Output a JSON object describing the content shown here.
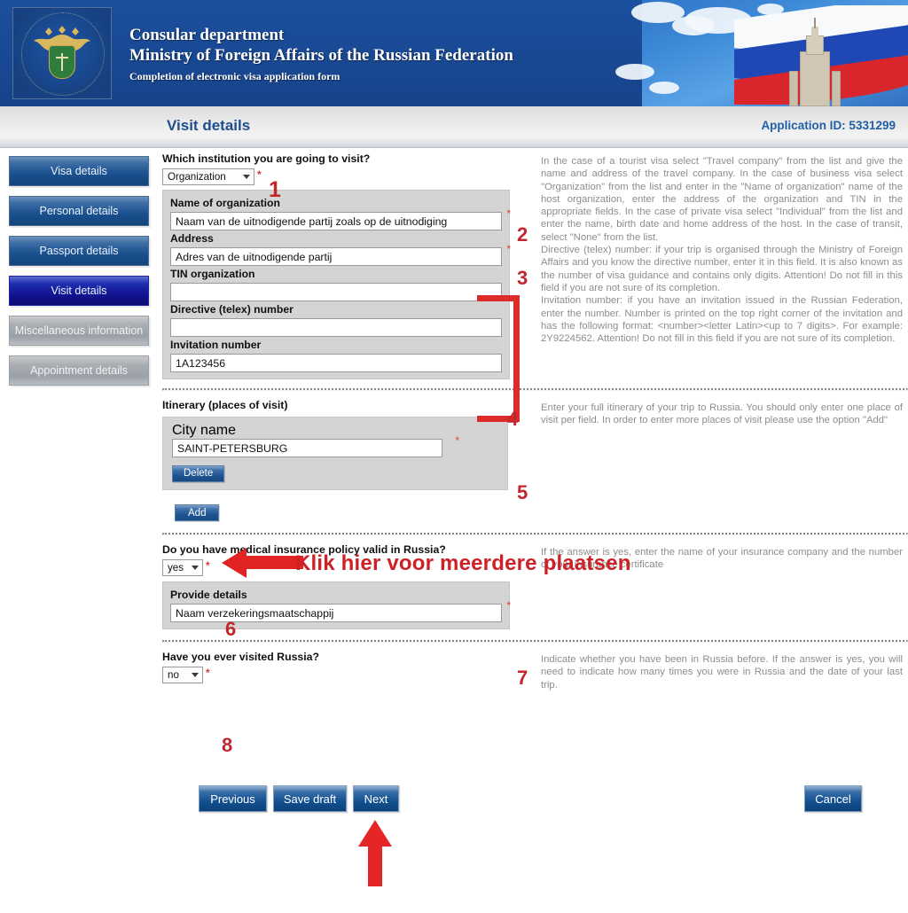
{
  "banner": {
    "emblem_alt": "russian-mfa-emblem",
    "line1": "Consular department",
    "line2": "Ministry of Foreign Affairs of the Russian Federation",
    "line3": "Completion of electronic visa application form"
  },
  "subheader": {
    "page_title": "Visit details",
    "application_id": "Application ID: 5331299"
  },
  "sidebar": {
    "items": [
      {
        "label": "Visa details",
        "state": "blue"
      },
      {
        "label": "Personal details",
        "state": "blue"
      },
      {
        "label": "Passport details",
        "state": "blue"
      },
      {
        "label": "Visit details",
        "state": "active"
      },
      {
        "label": "Miscellaneous information",
        "state": "gray"
      },
      {
        "label": "Appointment details",
        "state": "gray"
      }
    ]
  },
  "sections": {
    "institution": {
      "question": "Which institution you are going to visit?",
      "select_value": "Organization",
      "required_mark": "*",
      "fields": [
        {
          "label": "Name of organization",
          "value": "Naam van de uitnodigende partij zoals op de uitnodiging",
          "required": true
        },
        {
          "label": "Address",
          "value": "Adres van de uitnodigende partij",
          "required": true
        },
        {
          "label": "TIN organization",
          "value": "",
          "required": false
        },
        {
          "label": "Directive (telex) number",
          "value": "",
          "required": false
        },
        {
          "label": "Invitation number",
          "value": "1A123456",
          "required": false
        }
      ],
      "help": "In the case of a tourist visa select \"Travel company\" from the list and give the name and address of the travel company. In the case of business visa select \"Organization\" from the list and enter in the \"Name of organization\" name of the host organization, enter the address of the organization and TIN in the appropriate fields. In the case of private visa select \"Individual\" from the list and enter the name, birth date and home address of the host. In the case of transit, select \"None\" from the list.",
      "help2": "Directive (telex) number: if your trip is organised through the Ministry of Foreign Affairs and you know the directive number, enter it in this field. It is also known as the number of visa guidance and contains only digits. Attention! Do not fill in this field if you are not sure of its completion.",
      "help3": "Invitation number: if you have an invitation issued in the Russian Federation, enter the number. Number is printed on the top right corner of the invitation and has the following format: <number><letter Latin><up to 7 digits>. For example: 2Y9224562. Attention! Do not fill in this field if you are not sure of its completion."
    },
    "itinerary": {
      "title": "Itinerary (places of visit)",
      "city_label": "City name",
      "city_value": "SAINT-PETERSBURG",
      "delete_label": "Delete",
      "add_label": "Add",
      "help": "Enter your full itinerary of your trip to Russia. You should only enter one place of visit per field. In order to enter more places of visit please use the option \"Add\""
    },
    "insurance": {
      "question": "Do you have medical insurance policy valid in Russia?",
      "select_value": "yes",
      "details_label": "Provide details",
      "details_value": "Naam verzekeringsmaatschappij",
      "help": "If the answer is yes, enter the name of your insurance company and the number of your insurance certificate"
    },
    "visited": {
      "question": "Have you ever visited Russia?",
      "select_value": "no",
      "help": "Indicate whether you have been in Russia before. If the answer is yes, you will need to indicate how many times you were in Russia and the date of your last trip."
    }
  },
  "buttons": {
    "previous": "Previous",
    "save_draft": "Save draft",
    "next": "Next",
    "cancel": "Cancel"
  },
  "annotations": {
    "n1": "1",
    "n2": "2",
    "n3": "3",
    "n4": "4",
    "n5": "5",
    "n6": "6",
    "n7": "7",
    "n8": "8",
    "klik_text": "Klik hier voor meerdere plaatsen",
    "accent_color": "#cc2127"
  }
}
